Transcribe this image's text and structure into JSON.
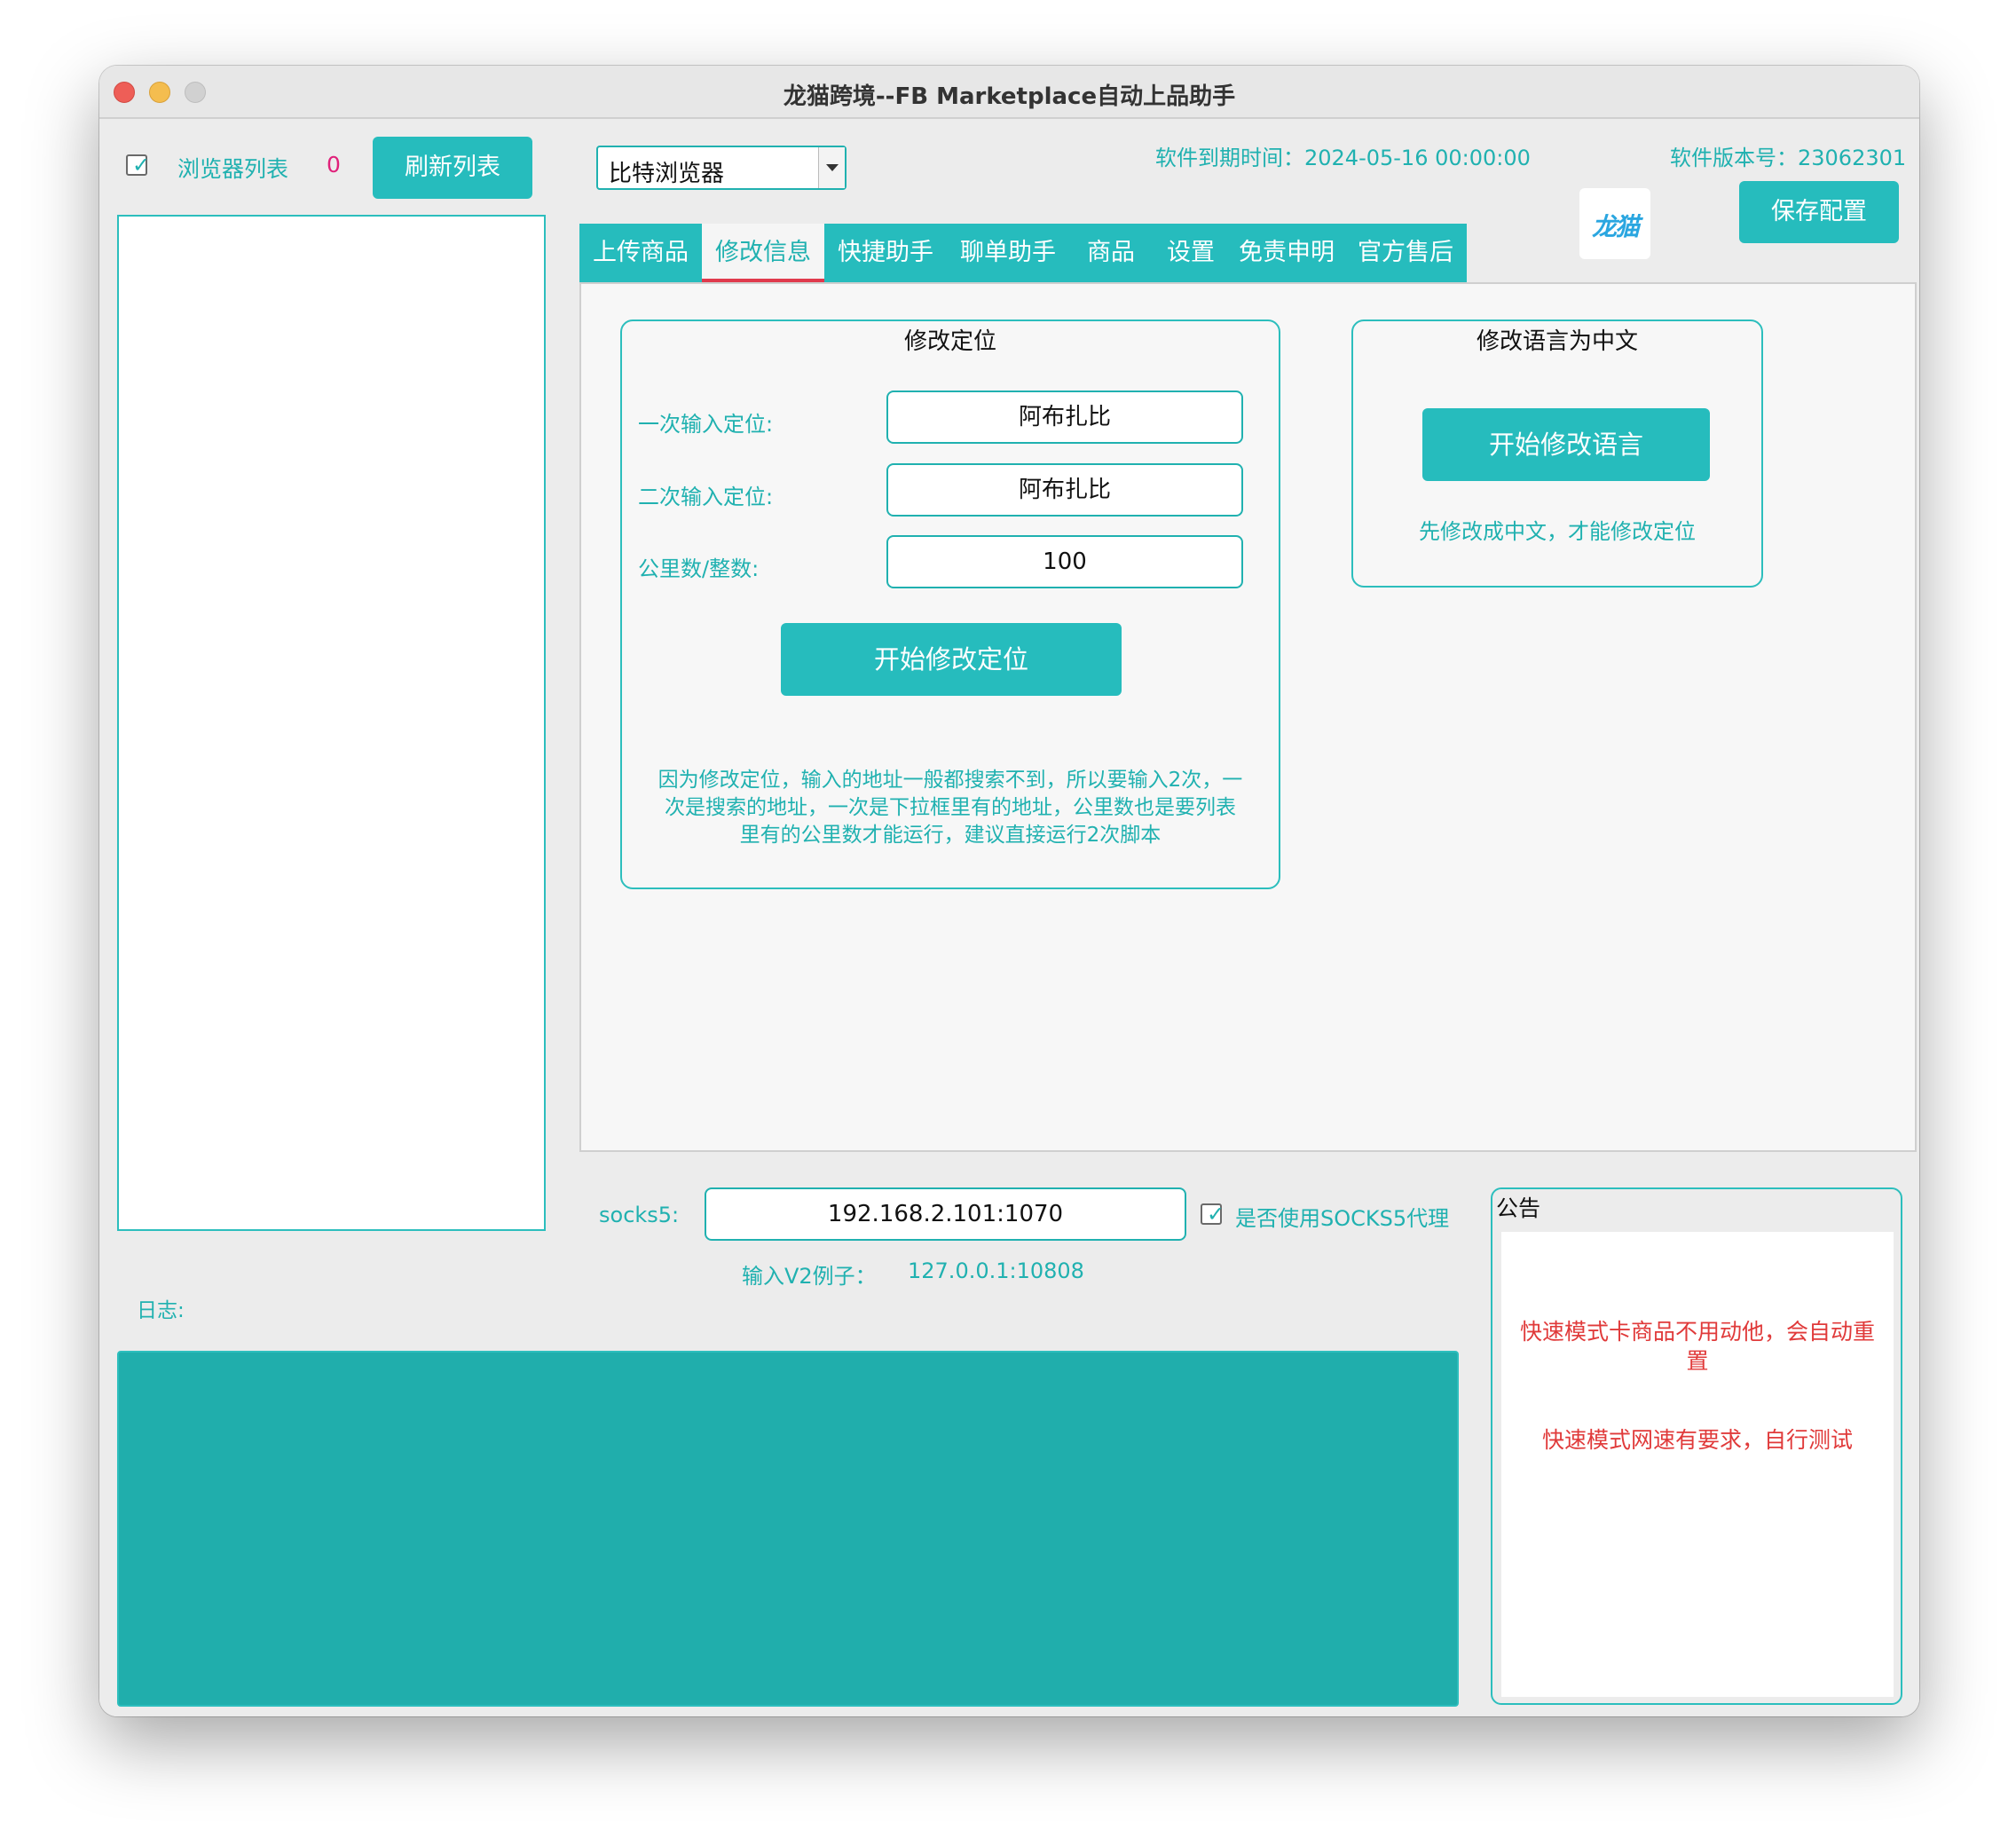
{
  "window": {
    "title": "龙猫跨境--FB Marketplace自动上品助手"
  },
  "browser_list": {
    "checked": true,
    "label": "浏览器列表",
    "count": "0",
    "refresh_label": "刷新列表"
  },
  "browser_select": {
    "value": "比特浏览器"
  },
  "header": {
    "expiry_text": "软件到期时间：2024-05-16 00:00:00",
    "version_text": "软件版本号：23062301",
    "logo_text": "龙猫",
    "save_label": "保存配置"
  },
  "tabs": [
    {
      "label": "上传商品"
    },
    {
      "label": "修改信息"
    },
    {
      "label": "快捷助手"
    },
    {
      "label": "聊单助手"
    },
    {
      "label": "商品"
    },
    {
      "label": "设置"
    },
    {
      "label": "免责申明"
    },
    {
      "label": "官方售后"
    }
  ],
  "active_tab": "修改信息",
  "location_group": {
    "title": "修改定位",
    "first_label": "一次输入定位:",
    "first_value": "阿布扎比",
    "second_label": "二次输入定位:",
    "second_value": "阿布扎比",
    "km_label": "公里数/整数:",
    "km_value": "100",
    "start_label": "开始修改定位",
    "note_lines": [
      "因为修改定位，输入的地址一般都搜索不到，所以要输入2次，一",
      "次是搜索的地址，一次是下拉框里有的地址，公里数也是要列表",
      "里有的公里数才能运行，建议直接运行2次脚本"
    ]
  },
  "language_group": {
    "title": "修改语言为中文",
    "start_label": "开始修改语言",
    "note": "先修改成中文，才能修改定位"
  },
  "proxy": {
    "label": "socks5:",
    "value": "192.168.2.101:1070",
    "use_checked": true,
    "use_label": "是否使用SOCKS5代理",
    "example_label": "输入V2例子：",
    "example_value": "127.0.0.1:10808"
  },
  "log": {
    "label": "日志:"
  },
  "notice": {
    "title": "公告",
    "line1a": "快速模式卡商品不用动他，会自动重",
    "line1b": "置",
    "line2": "快速模式网速有要求，自行测试"
  },
  "colors": {
    "accent": "#26bcbd",
    "accent_text": "#20b1b0",
    "tab_indicator": "#e03a4d",
    "notice_text": "#e03a3a",
    "count": "#e0217a"
  }
}
